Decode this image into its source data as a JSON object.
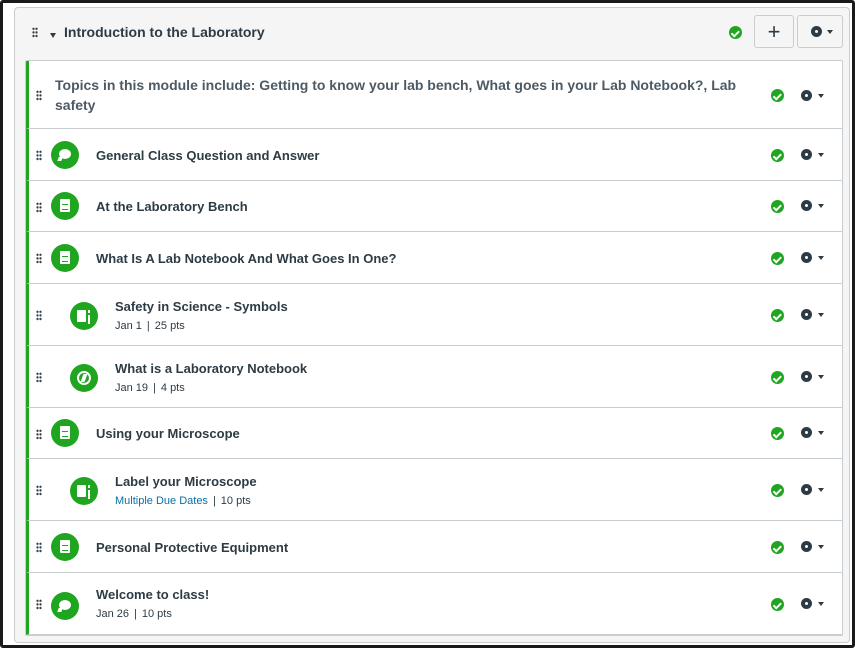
{
  "module": {
    "title": "Introduction to the Laboratory",
    "add_label": "+",
    "status_icon": "published-check-icon",
    "accent_color": "#1fa51f"
  },
  "items": [
    {
      "type": "text-header",
      "title": "Topics in this module include: Getting to know your lab bench, What goes in your Lab Notebook?, Lab safety",
      "published": true
    },
    {
      "type": "discussion",
      "icon": "discussion-icon",
      "title": "General Class Question and Answer",
      "published": true
    },
    {
      "type": "page",
      "icon": "page-icon",
      "title": "At the Laboratory Bench",
      "published": true
    },
    {
      "type": "page",
      "icon": "page-icon",
      "title": "What Is A Lab Notebook And What Goes In One?",
      "published": true
    },
    {
      "type": "assignment",
      "icon": "assignment-icon",
      "title": "Safety in Science - Symbols",
      "due": "Jan 1",
      "points": "25 pts",
      "published": true
    },
    {
      "type": "quiz",
      "icon": "quiz-icon",
      "title": "What is a Laboratory Notebook",
      "due": "Jan 19",
      "points": "4 pts",
      "published": true
    },
    {
      "type": "page",
      "icon": "page-icon",
      "title": "Using your Microscope",
      "published": true
    },
    {
      "type": "assignment",
      "icon": "assignment-icon",
      "title": "Label your Microscope",
      "due": "Multiple Due Dates",
      "points": "10 pts",
      "published": true
    },
    {
      "type": "page",
      "icon": "page-icon",
      "title": "Personal Protective Equipment",
      "published": true
    },
    {
      "type": "discussion",
      "icon": "discussion-icon",
      "title": "Welcome to class!",
      "due": "Jan 26",
      "points": "10 pts",
      "published": true
    }
  ],
  "meta_separator": "|"
}
